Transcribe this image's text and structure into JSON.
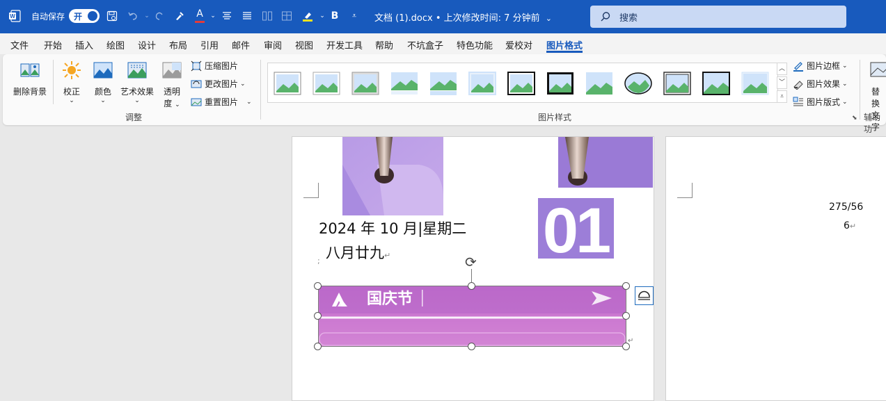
{
  "titlebar": {
    "autosave_label": "自动保存",
    "autosave_state": "开",
    "doc_title": "文档 (1).docx • 上次修改时间: 7 分钟前",
    "bold_label": "B",
    "font_color_label": "A",
    "search_placeholder": "搜索"
  },
  "menu": {
    "items": [
      "文件",
      "开始",
      "插入",
      "绘图",
      "设计",
      "布局",
      "引用",
      "邮件",
      "审阅",
      "视图",
      "开发工具",
      "帮助",
      "不坑盒子",
      "特色功能",
      "爱校对",
      "图片格式"
    ],
    "active": "图片格式"
  },
  "ribbon": {
    "remove_bg": "删除背景",
    "corrections": "校正",
    "color": "颜色",
    "artistic": "艺术效果",
    "transparency_line1": "透明",
    "transparency_line2": "度",
    "compress": "压缩图片",
    "change": "更改图片",
    "reset": "重置图片",
    "adjust_group": "调整",
    "styles_group": "图片样式",
    "border": "图片边框",
    "effects": "图片效果",
    "layout": "图片版式",
    "alt_text_line1": "替换",
    "alt_text_line2": "文字",
    "accessibility_group": "辅助功"
  },
  "document": {
    "date_line": "2024 年 10 月|星期二",
    "lunar_line": "八月廿九",
    "big_number": "01",
    "banner_text": "国庆节",
    "page2_line1": "275/56",
    "page2_line2": "6"
  },
  "colors": {
    "titlebar": "#185abd",
    "accent": "#185abd",
    "purple_light": "#c2a6e6",
    "purple_mid": "#9b7ad8",
    "banner": "#c97ad0"
  }
}
